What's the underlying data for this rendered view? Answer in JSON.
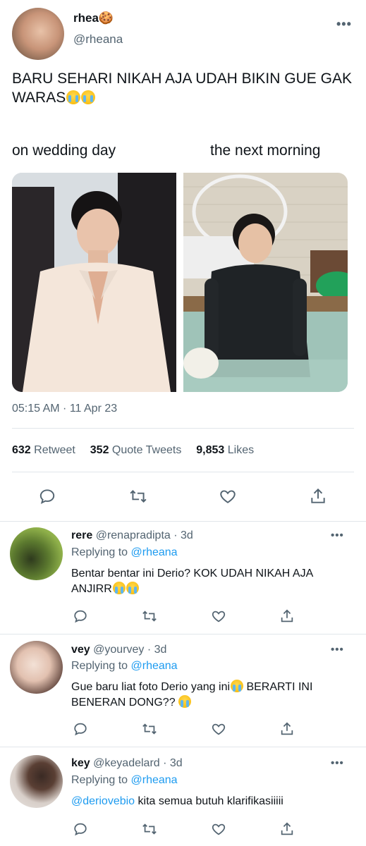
{
  "main_tweet": {
    "display_name": "rhea🍪",
    "handle": "@rheana",
    "text": "BARU SEHARI NIKAH AJA UDAH BIKIN GUE GAK WARAS",
    "caption_left": "on wedding day",
    "caption_right": "the next morning",
    "image_left_desc": "man-in-white-shirt-photo",
    "image_right_desc": "man-in-pool-photo",
    "timestamp": "05:15 AM · 11 Apr 23",
    "stats": {
      "retweets_count": "632",
      "retweets_label": "Retweet",
      "quotes_count": "352",
      "quotes_label": "Quote Tweets",
      "likes_count": "9,853",
      "likes_label": "Likes"
    }
  },
  "replies": [
    {
      "name": "rere",
      "handle": "@renapradipta",
      "time": "· 3d",
      "replying_prefix": "Replying to",
      "replying_to": "@rheana",
      "text": "Bentar bentar ini Derio? KOK UDAH NIKAH AJA ANJIRR"
    },
    {
      "name": "vey",
      "handle": "@yourvey",
      "time": "· 3d",
      "replying_prefix": "Replying to",
      "replying_to": "@rheana",
      "text_a": "Gue baru liat foto Derio yang ini",
      "text_b": " BERARTI INI BENERAN DONG??"
    },
    {
      "name": "key",
      "handle": "@keyadelard",
      "time": "· 3d",
      "replying_prefix": "Replying to",
      "replying_to": "@rheana",
      "mention": "@deriovebio",
      "text": " kita semua butuh klarifikasiiiii"
    }
  ],
  "icons": [
    "reply-icon",
    "retweet-icon",
    "like-icon",
    "share-icon",
    "more-icon"
  ],
  "colors": {
    "accent": "#1d9bf0",
    "muted": "#536471",
    "text": "#0f1419",
    "divider": "#e1e6ea"
  }
}
